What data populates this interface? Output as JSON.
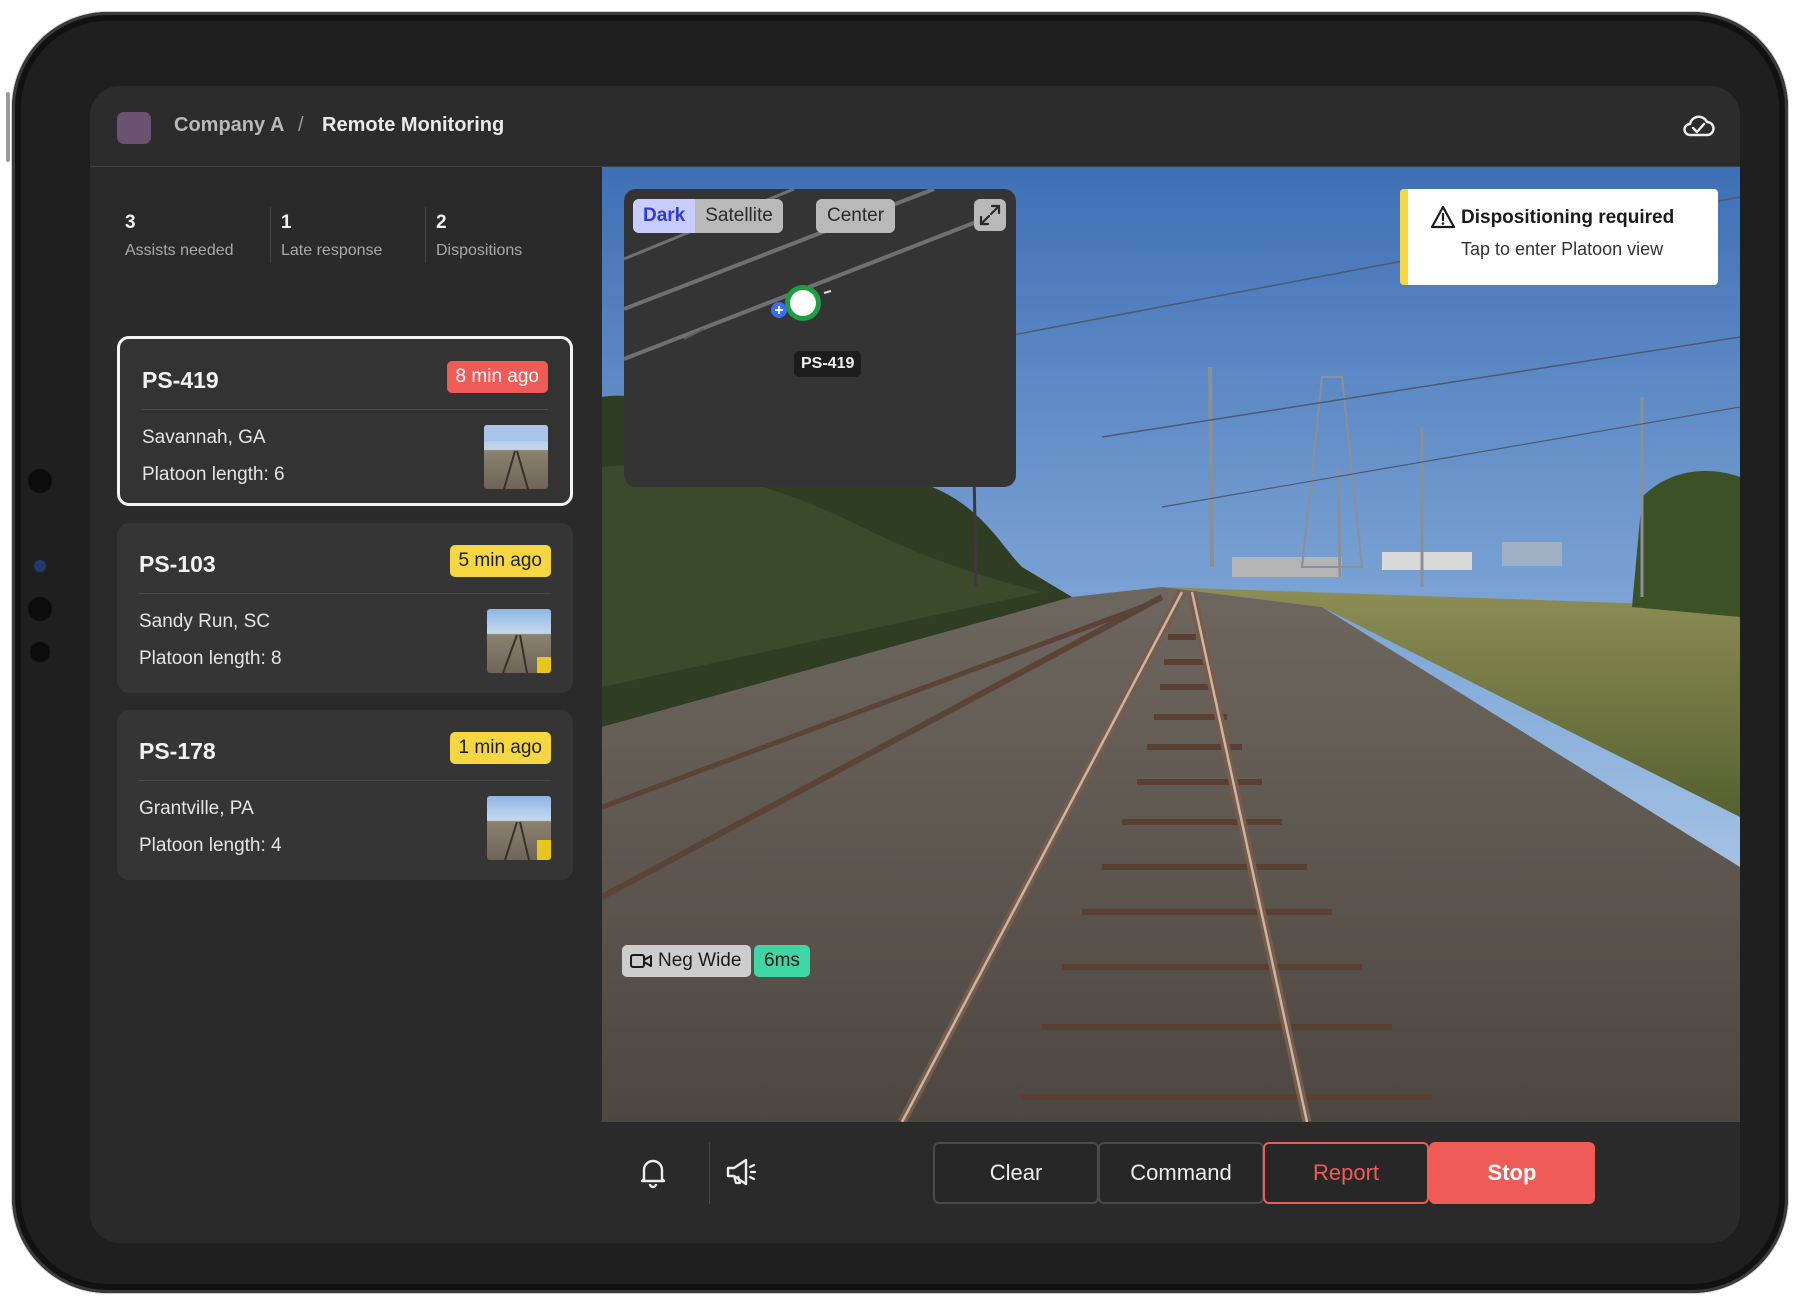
{
  "header": {
    "company": "Company A",
    "separator": "/",
    "page": "Remote Monitoring",
    "sync_icon": "cloud-check-icon"
  },
  "stats": [
    {
      "value": "3",
      "label": "Assists needed"
    },
    {
      "value": "1",
      "label": "Late response"
    },
    {
      "value": "2",
      "label": "Dispositions"
    }
  ],
  "platoons": [
    {
      "id": "PS-419",
      "time": "8 min ago",
      "status": "late",
      "location": "Savannah, GA",
      "length": "Platoon length: 6",
      "selected": true
    },
    {
      "id": "PS-103",
      "time": "5 min ago",
      "status": "warning",
      "location": "Sandy Run, SC",
      "length": "Platoon length: 8",
      "selected": false
    },
    {
      "id": "PS-178",
      "time": "1 min ago",
      "status": "warning",
      "location": "Grantville, PA",
      "length": "Platoon length: 4",
      "selected": false
    }
  ],
  "map": {
    "modes": [
      "Dark",
      "Satellite"
    ],
    "active_mode": "Dark",
    "center_label": "Center",
    "marker_label": "PS-419",
    "expand_icon": "expand-icon"
  },
  "notification": {
    "title": "Dispositioning required",
    "subtitle": "Tap to enter Platoon view",
    "icon": "warning-icon"
  },
  "camera": {
    "name": "Neg Wide",
    "latency": "6ms",
    "icon": "video-camera-icon"
  },
  "actions": {
    "bell_icon": "bell-icon",
    "megaphone_icon": "megaphone-icon",
    "clear": "Clear",
    "command": "Command",
    "report": "Report",
    "stop": "Stop"
  },
  "colors": {
    "accent_red": "#ef5b56",
    "accent_yellow": "#f6d741",
    "latency_green": "#3fd6a6",
    "map_active": "#2e3bd6"
  }
}
